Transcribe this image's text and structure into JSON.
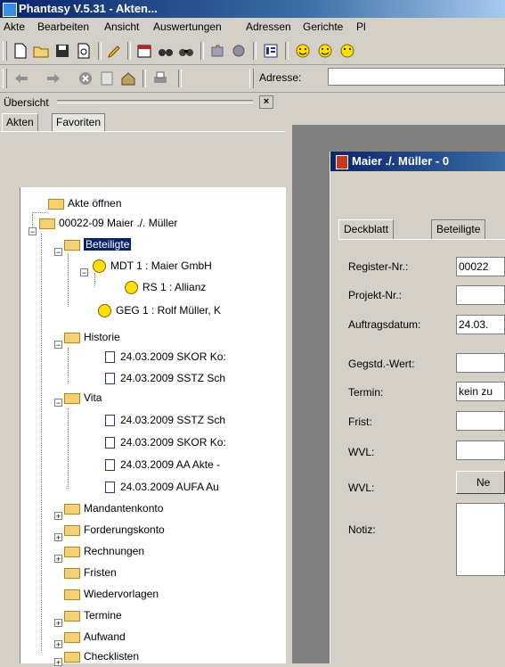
{
  "window": {
    "title": "Phantasy V.5.31 - Akten..."
  },
  "menu": [
    "Akte",
    "Bearbeiten",
    "Ansicht",
    "Auswertungen",
    "Adressen",
    "Gerichte",
    "Pl"
  ],
  "address": {
    "label": "Adresse:",
    "value": ""
  },
  "pane": {
    "title": "Übersicht",
    "close": "×"
  },
  "tabs": {
    "akten": "Akten",
    "favoriten": "Favoriten"
  },
  "tree": {
    "open": "Akte öffnen",
    "root": "00022-09 Maier ./. Müller",
    "beteiligte": "Beteiligte",
    "mdt": "MDT 1 : Maier GmbH",
    "rs": "RS 1 : Allianz",
    "geg": "GEG 1 : Rolf Müller, K",
    "historie": "Historie",
    "h1": "24.03.2009 SKOR Ko:",
    "h2": "24.03.2009 SSTZ Sch",
    "vita": "Vita",
    "v1": "24.03.2009 SSTZ Sch",
    "v2": "24.03.2009 SKOR Ko:",
    "v3": "24.03.2009 AA Akte -",
    "v4": "24.03.2009 AUFA Au",
    "mandantenkonto": "Mandantenkonto",
    "forderungskonto": "Forderungskonto",
    "rechnungen": "Rechnungen",
    "fristen": "Fristen",
    "wiedervorlagen": "Wiedervorlagen",
    "termine": "Termine",
    "aufwand": "Aufwand",
    "checklisten": "Checklisten"
  },
  "child": {
    "title": "Maier ./. Müller - 0",
    "tabs": {
      "deckblatt": "Deckblatt",
      "beteiligte": "Beteiligte"
    },
    "labels": {
      "register": "Register-Nr.:",
      "projekt": "Projekt-Nr.:",
      "auftrag": "Auftragsdatum:",
      "gegstd": "Gegstd.-Wert:",
      "termin": "Termin:",
      "frist": "Frist:",
      "wvl1": "WVL:",
      "wvl2": "WVL:",
      "notiz": "Notiz:"
    },
    "values": {
      "register": "00022",
      "projekt": "",
      "auftrag": "24.03.",
      "gegstd": "",
      "termin": "kein zu",
      "frist": "",
      "wvl1": ""
    },
    "button": "Ne"
  },
  "icons": {
    "toolbar1": [
      "new-document-icon",
      "open-folder-icon",
      "save-disk-icon",
      "print-preview-icon",
      "pencil-icon",
      "calendar-icon",
      "binoculars-icon",
      "search-binoculars-icon",
      "puzzle-icon",
      "globe-icon",
      "list-view-icon",
      "smiley-face-icon",
      "smiley-icon",
      "smiley-icon"
    ],
    "toolbar2": [
      "back-arrow-icon",
      "forward-arrow-icon",
      "stop-icon",
      "refresh-icon",
      "home-icon",
      "print-icon"
    ]
  }
}
